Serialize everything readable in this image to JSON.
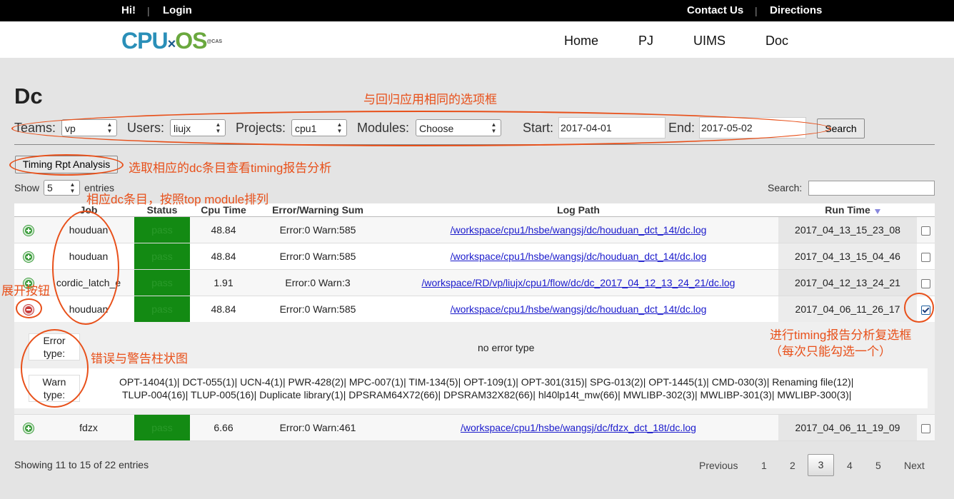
{
  "topbar": {
    "hi": "Hi!",
    "login": "Login",
    "contact": "Contact Us",
    "directions": "Directions",
    "sep": "|"
  },
  "logo": {
    "cpu": "CPU",
    "x": "×",
    "os": "OS",
    "sup": "@CAS"
  },
  "nav": [
    "Home",
    "PJ",
    "UIMS",
    "Doc"
  ],
  "page_title": "Dc",
  "filters": {
    "teams_label": "Teams:",
    "teams_value": "vp",
    "users_label": "Users:",
    "users_value": "liujx",
    "projects_label": "Projects:",
    "projects_value": "cpu1",
    "modules_label": "Modules:",
    "modules_value": "Choose",
    "start_label": "Start:",
    "start_value": "2017-04-01",
    "end_label": "End:",
    "end_value": "2017-05-02",
    "search_button": "Search"
  },
  "timing_button": "Timing Rpt Analysis",
  "length": {
    "show": "Show",
    "value": "5",
    "entries": "entries"
  },
  "search_label": "Search:",
  "table": {
    "headers": [
      "Job",
      "Status",
      "Cpu Time",
      "Error/Warning Sum",
      "Log Path",
      "Run Time"
    ],
    "rows": [
      {
        "job": "houduan",
        "status": "pass",
        "cpu": "48.84",
        "sum": "Error:0 Warn:585",
        "log": "/workspace/cpu1/hsbe/wangsj/dc/houduan_dct_14t/dc.log",
        "run": "2017_04_13_15_23_08",
        "checked": false,
        "expanded": false
      },
      {
        "job": "houduan",
        "status": "pass",
        "cpu": "48.84",
        "sum": "Error:0 Warn:585",
        "log": "/workspace/cpu1/hsbe/wangsj/dc/houduan_dct_14t/dc.log",
        "run": "2017_04_13_15_04_46",
        "checked": false,
        "expanded": false
      },
      {
        "job": "cordic_latch_e",
        "status": "pass",
        "cpu": "1.91",
        "sum": "Error:0 Warn:3",
        "log": "/workspace/RD/vp/liujx/cpu1/flow/dc/dc_2017_04_12_13_24_21/dc.log",
        "run": "2017_04_12_13_24_21",
        "checked": false,
        "expanded": false
      },
      {
        "job": "houduan",
        "status": "pass",
        "cpu": "48.84",
        "sum": "Error:0 Warn:585",
        "log": "/workspace/cpu1/hsbe/wangsj/dc/houduan_dct_14t/dc.log",
        "run": "2017_04_06_11_26_17",
        "checked": true,
        "expanded": true
      },
      {
        "job": "fdzx",
        "status": "pass",
        "cpu": "6.66",
        "sum": "Error:0 Warn:461",
        "log": "/workspace/cpu1/hsbe/wangsj/dc/fdzx_dct_18t/dc.log",
        "run": "2017_04_06_11_19_09",
        "checked": false,
        "expanded": false
      }
    ]
  },
  "detail": {
    "error_label_1": "Error",
    "error_label_2": "type:",
    "error_value": "no error type",
    "warn_label_1": "Warn",
    "warn_label_2": "type:",
    "warn_line_1": "OPT-1404(1)| DCT-055(1)| UCN-4(1)| PWR-428(2)| MPC-007(1)| TIM-134(5)| OPT-109(1)| OPT-301(315)| SPG-013(2)| OPT-1445(1)| CMD-030(3)| Renaming file(12)|",
    "warn_line_2": "TLUP-004(16)| TLUP-005(16)| Duplicate library(1)| DPSRAM64X72(66)| DPSRAM32X82(66)| hl40lp14t_mw(66)| MWLIBP-302(3)| MWLIBP-301(3)| MWLIBP-300(3)|"
  },
  "info": "Showing 11 to 15 of 22 entries",
  "pager": {
    "previous": "Previous",
    "pages": [
      "1",
      "2",
      "3",
      "4",
      "5"
    ],
    "current": "3",
    "next": "Next"
  },
  "annotations": {
    "filters": "与回归应用相同的选项框",
    "timing": "选取相应的dc条目查看timing报告分析",
    "job": "相应dc条目，按照top module排列",
    "expand": "展开按钮",
    "chart": "错误与警告柱状图",
    "checkbox_1": "进行timing报告分析复选框",
    "checkbox_2": "（每次只能勾选一个）"
  },
  "colors": {
    "annotation": "#e8501a",
    "pass": "#138a13",
    "link": "#1a1acc"
  }
}
